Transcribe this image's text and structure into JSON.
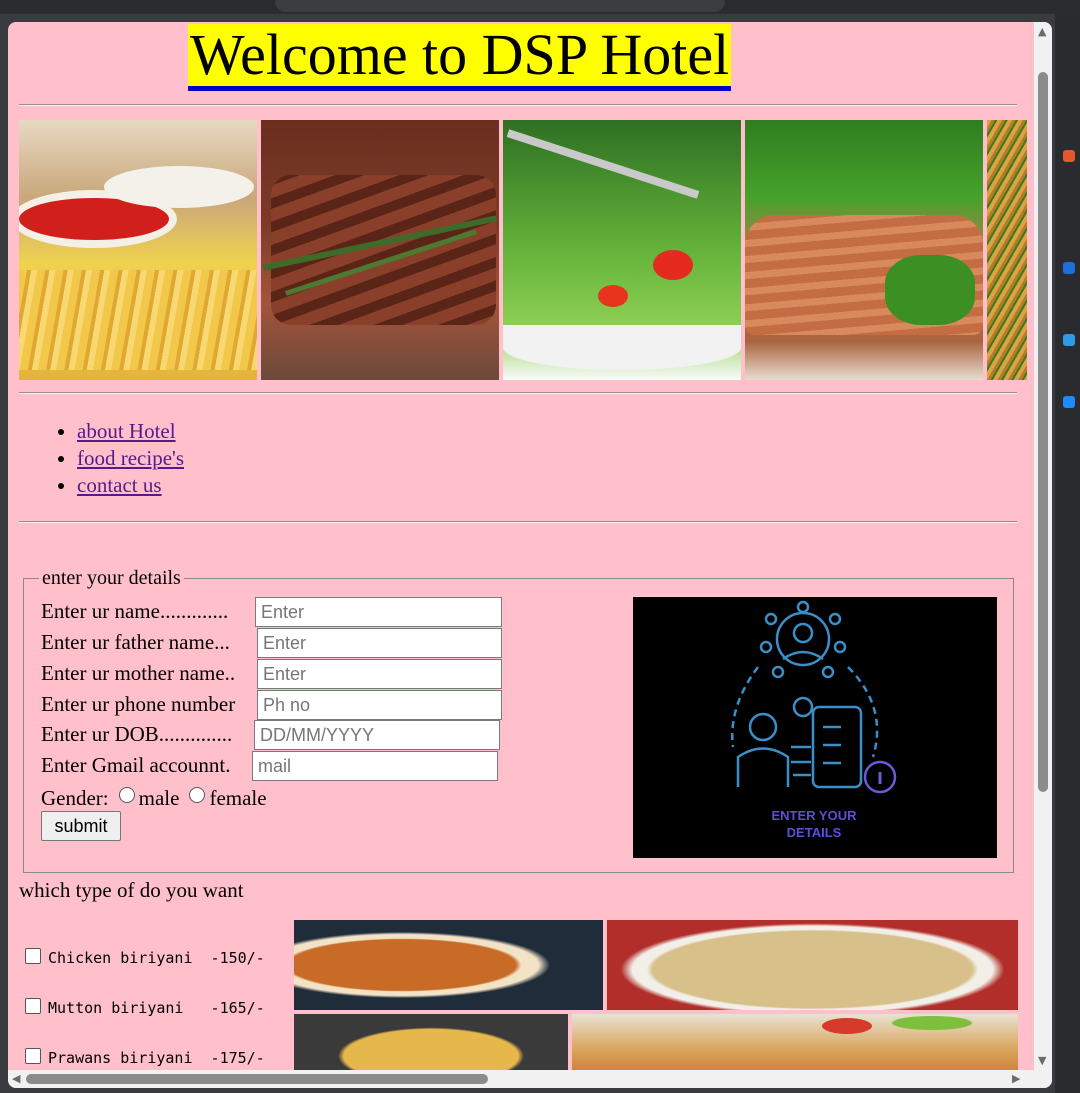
{
  "page": {
    "title": "Welcome to DSP Hotel"
  },
  "banner": {
    "panels": [
      "fries-with-ketchup",
      "grilled-steak",
      "green-salad",
      "chicken-with-broccoli",
      "noodles"
    ]
  },
  "nav": {
    "links": [
      "about Hotel",
      "food recipe's",
      "contact us"
    ]
  },
  "form": {
    "legend": "enter your details",
    "fields": [
      {
        "label": "Enter ur name.............",
        "placeholder": "Enter"
      },
      {
        "label": "Enter ur father name...",
        "placeholder": "Enter"
      },
      {
        "label": "Enter ur mother name..",
        "placeholder": "Enter"
      },
      {
        "label": "Enter ur phone number",
        "placeholder": "Ph no"
      },
      {
        "label": "Enter ur DOB..............",
        "placeholder": "DD/MM/YYYY"
      },
      {
        "label": "Enter Gmail accounnt.",
        "placeholder": "mail"
      }
    ],
    "gender_label": "Gender:",
    "gender_options": [
      "male",
      "female"
    ],
    "submit_label": "submit",
    "image_caption_line1": "ENTER YOUR",
    "image_caption_line2": "DETAILS"
  },
  "menu": {
    "heading": "which type of do you want",
    "items": [
      {
        "label": "Chicken biriyani  -150/-"
      },
      {
        "label": "Mutton biriyani   -165/-"
      },
      {
        "label": "Prawans biriyani  -175/-"
      }
    ]
  },
  "colors": {
    "page_bg": "#ffc0cb",
    "title_highlight": "#ffff00",
    "link": "#551a8b",
    "image_lines": "#3b8fc9",
    "caption": "#5b4fd6"
  }
}
